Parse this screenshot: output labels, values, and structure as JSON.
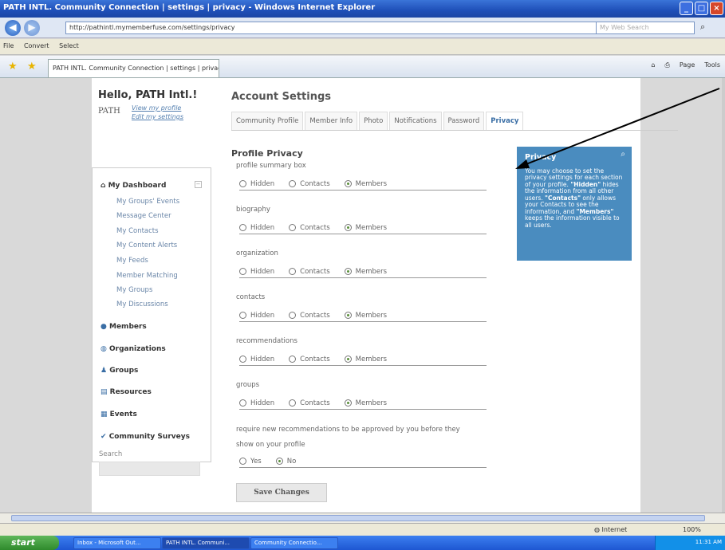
{
  "window": {
    "title": "PATH INTL. Community Connection | settings | privacy - Windows Internet Explorer"
  },
  "address": {
    "url": "http://pathintl.mymemberfuse.com/settings/privacy",
    "search_placeholder": "My Web Search"
  },
  "menubar": {
    "file": "File",
    "convert": "Convert",
    "select": "Select"
  },
  "tab": {
    "label": "PATH INTL. Community Connection | settings | privacy"
  },
  "toolbar": {
    "page": "Page",
    "tools": "Tools"
  },
  "sidebar": {
    "hello": "Hello, PATH Intl.!",
    "logo_text": "PATH",
    "view_profile": "View my profile",
    "edit_settings": "Edit my settings",
    "dashboard": "My Dashboard",
    "dashboard_items": [
      "My Groups' Events",
      "Message Center",
      "My Contacts",
      "My Content Alerts",
      "My Feeds",
      "Member Matching",
      "My Groups",
      "My Discussions"
    ],
    "members": "Members",
    "organizations": "Organizations",
    "groups": "Groups",
    "resources": "Resources",
    "events": "Events",
    "surveys": "Community Surveys",
    "search_label": "Search"
  },
  "main": {
    "title": "Account Settings",
    "tabs": [
      "Community Profile",
      "Member Info",
      "Photo",
      "Notifications",
      "Password",
      "Privacy"
    ],
    "section_title": "Profile Privacy",
    "options": {
      "hidden": "Hidden",
      "contacts": "Contacts",
      "members": "Members"
    },
    "fields": [
      "profile summary box",
      "biography",
      "organization",
      "contacts",
      "recommendations",
      "groups"
    ],
    "approve_text_1": "require new recommendations to be approved by you before they",
    "approve_text_2": "show on your profile",
    "yes": "Yes",
    "no": "No",
    "save": "Save Changes"
  },
  "privacy_box": {
    "title": "Privacy",
    "body_1": "You may choose to set the privacy settings for each section of your profile.",
    "hidden_bold": "\"Hidden\"",
    "body_2": " hides the information from all other users.",
    "contacts_bold": "\"Contacts\"",
    "body_3": " only allows your Contacts to see the information, and ",
    "members_bold": "\"Members\"",
    "body_4": " keeps the information visible to all users."
  },
  "statusbar": {
    "zone": "Internet",
    "zoom": "100%"
  },
  "taskbar": {
    "start": "start",
    "items": [
      "Inbox - Microsoft Out...",
      "PATH INTL. Communi...",
      "Community Connectio..."
    ],
    "clock": "11:31 AM"
  }
}
